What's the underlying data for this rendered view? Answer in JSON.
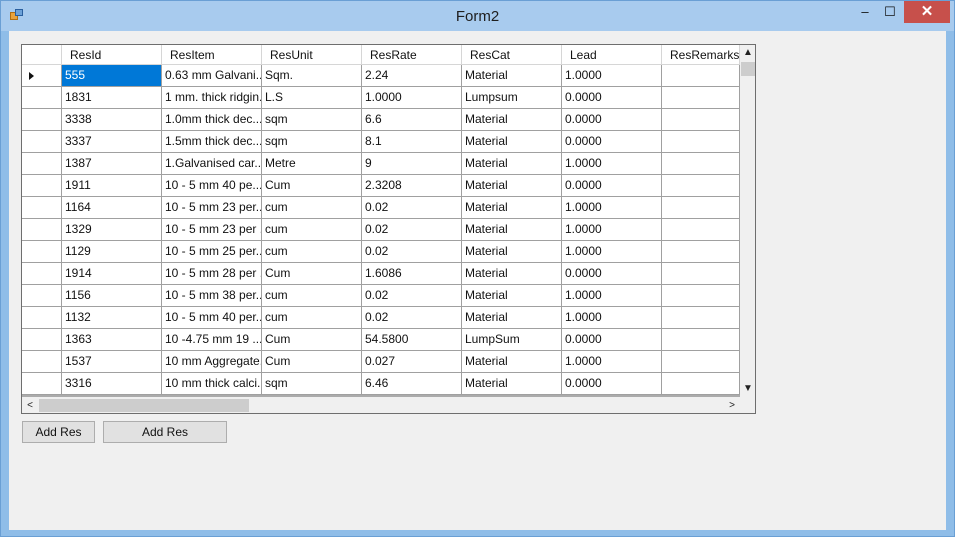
{
  "window": {
    "title": "Form2",
    "minimize": "–",
    "maximize": "☐",
    "close": "✕"
  },
  "grid": {
    "columns": [
      "ResId",
      "ResItem",
      "ResUnit",
      "ResRate",
      "ResCat",
      "Lead",
      "ResRemarks"
    ],
    "selected_row": 0,
    "rows": [
      [
        "555",
        "0.63 mm Galvani...",
        "Sqm.",
        "2.24",
        "Material",
        "1.0000",
        ""
      ],
      [
        "1831",
        "1 mm. thick ridgin...",
        "L.S",
        "1.0000",
        "Lumpsum",
        "0.0000",
        ""
      ],
      [
        "3338",
        "1.0mm thick dec...",
        "sqm",
        "6.6",
        "Material",
        "0.0000",
        ""
      ],
      [
        "3337",
        "1.5mm thick dec...",
        "sqm",
        "8.1",
        "Material",
        "0.0000",
        ""
      ],
      [
        "1387",
        "1.Galvanised car...",
        "Metre",
        "9",
        "Material",
        "1.0000",
        ""
      ],
      [
        "1911",
        "10 - 5 mm   40 pe...",
        "Cum",
        "2.3208",
        "Material",
        "0.0000",
        ""
      ],
      [
        "1164",
        "10 - 5 mm 23  per...",
        "cum",
        "0.02",
        "Material",
        "1.0000",
        ""
      ],
      [
        "1329",
        "10 - 5 mm 23 per ...",
        "cum",
        "0.02",
        "Material",
        "1.0000",
        ""
      ],
      [
        "1129",
        "10 - 5 mm 25  per...",
        "cum",
        "0.02",
        "Material",
        "1.0000",
        ""
      ],
      [
        "1914",
        "10 - 5 mm 28 per ...",
        "Cum",
        "1.6086",
        "Material",
        "0.0000",
        ""
      ],
      [
        "1156",
        "10 - 5 mm 38  per...",
        "cum",
        "0.02",
        "Material",
        "1.0000",
        ""
      ],
      [
        "1132",
        "10 - 5 mm 40  per...",
        "cum",
        "0.02",
        "Material",
        "1.0000",
        ""
      ],
      [
        "1363",
        "10 -4.75 mm 19  ...",
        "Cum",
        "54.5800",
        "LumpSum",
        "0.0000",
        ""
      ],
      [
        "1537",
        "10 mm Aggregate...",
        "Cum",
        "0.027",
        "Material",
        "1.0000",
        ""
      ],
      [
        "3316",
        "10 mm thick calci...",
        "sqm",
        "6.46",
        "Material",
        "0.0000",
        ""
      ]
    ]
  },
  "scrollbar": {
    "up": "▲",
    "down": "▼",
    "left": "<",
    "right": ">"
  },
  "buttons": {
    "add_res_1": "Add Res",
    "add_res_2": "Add Res"
  }
}
